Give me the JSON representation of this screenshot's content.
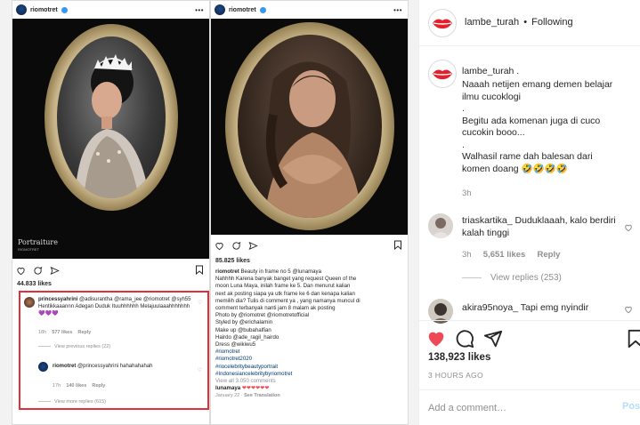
{
  "media": {
    "left_post": {
      "username": "riomotret",
      "brand": "Portraiture",
      "brand_sub": "RIOMOTRET",
      "likes": "44.833 likes",
      "comments": [
        {
          "username": "princessyahrini",
          "text": "@adisurantha @rama_jee @riomotret @syh55 Hentikkaaannn Adegan Duduk Ituuhhhhhh Melajuulaaahhhhhhh 💜💜💜",
          "time": "18h",
          "likes": "577 likes",
          "reply": "Reply"
        },
        {
          "username": "riomotret",
          "text": "@princessyahrini hahahahahah",
          "time": "17h",
          "likes": "140 likes",
          "reply": "Reply"
        }
      ],
      "view_previous": "View previous replies (22)",
      "view_more": "View more replies (615)"
    },
    "right_post": {
      "username": "riomotret",
      "likes": "85.825 likes",
      "caption_user": "riomotret",
      "caption": [
        "Beauty in frame no 5 @lunamaya",
        "Nahhhh Karena banyak banget yang request Queen of the",
        "moon Luna Maya, inilah frame ke 5. Dan menurut kalian",
        "next ak posting siapa ya utk frame ke 6 dan kenapa kalian",
        "memilih dia? Tulis di comment ya , yang namanya muncul di",
        "comment terbanyak nanti jam 8 malam ak posting",
        "Photo by @riomotret @riomotretofficial",
        "Styled by @erichalamin",
        "Make up @bubahalfian",
        "Hairdo @ade_ragil_hairdo",
        "Dress @wikiwu5",
        "#riomotret",
        "#riomotret2020",
        "#riocelebritybeautyportrait",
        "#Indonesiancelebritybyriomotret"
      ],
      "view_all": "View all 3.050 comments",
      "last_comment_user": "lunamaya",
      "last_comment_text": "❤❤❤❤❤❤",
      "date": "January 22",
      "see_translation": "See Translation"
    }
  },
  "sidebar": {
    "header": {
      "username": "lambe_turah",
      "separator": "•",
      "follow_state": "Following"
    },
    "caption": {
      "username": "lambe_turah",
      "suffix": ".",
      "text": "Naaah netijen emang demen belajar\nilmu cucoklogi\n.\nBegitu ada komenan juga di cuco\ncucokin booo...\n.\nWalhasil rame dah balesan dari\nkomen doang 🤣🤣🤣🤣",
      "time": "3h"
    },
    "comments": [
      {
        "username": "triaskartika_",
        "text": "Duduklaaah, kalo berdiri kalah tinggi",
        "time": "3h",
        "likes": "5,651 likes",
        "reply": "Reply",
        "view_replies": "View replies (253)"
      },
      {
        "username": "akira95noya_",
        "text": "Tapi emg nyindir"
      }
    ],
    "likes": "138,923 likes",
    "time_ago": "3 HOURS AGO",
    "add_comment_placeholder": "Add a comment…",
    "post_label": "Post"
  },
  "colors": {
    "highlight_border": "#e0303a",
    "like_red": "#ed4956",
    "link_blue": "#00376b",
    "verified_blue": "#3897f0"
  }
}
